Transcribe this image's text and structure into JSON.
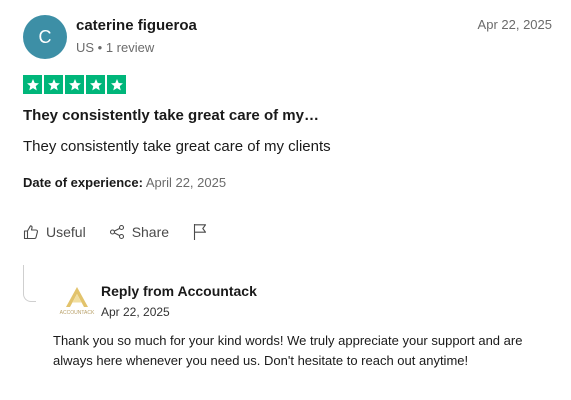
{
  "review": {
    "author": {
      "initial": "C",
      "name": "caterine figueroa",
      "meta": "US • 1 review",
      "avatar_color": "#3d8fa6"
    },
    "date": "Apr 22, 2025",
    "rating": 5,
    "rating_color": "#00b67a",
    "title": "They consistently take great care of my…",
    "body": "They consistently take great care of my clients",
    "experience": {
      "label": "Date of experience:",
      "value": "April 22, 2025"
    },
    "actions": {
      "useful_label": "Useful",
      "share_label": "Share",
      "flag_icon": "flag-icon"
    }
  },
  "reply": {
    "logo_text": "ACCOUNTACK",
    "author": "Reply from Accountack",
    "date": "Apr 22, 2025",
    "text": "Thank you so much for your kind words! We truly appreciate your support and are always here whenever you need us. Don't hesitate to reach out anytime!"
  }
}
